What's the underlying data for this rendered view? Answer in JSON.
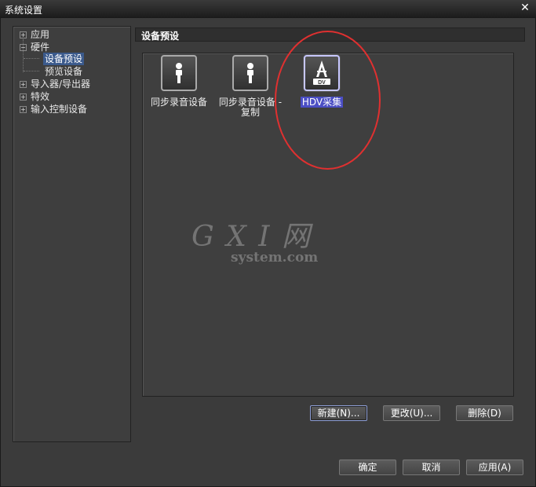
{
  "window": {
    "title": "系统设置"
  },
  "tree": {
    "items": [
      {
        "label": "应用",
        "expander": "+"
      },
      {
        "label": "硬件",
        "expander": "−"
      },
      {
        "label": "设备预设"
      },
      {
        "label": "预览设备"
      },
      {
        "label": "导入器/导出器",
        "expander": "+"
      },
      {
        "label": "特效",
        "expander": "+"
      },
      {
        "label": "输入控制设备",
        "expander": "+"
      }
    ]
  },
  "section": {
    "title": "设备预设"
  },
  "presets": [
    {
      "label": "同步录音设备",
      "icon": "microphone-icon"
    },
    {
      "label_line1": "同步录音设备 -",
      "label_line2": "复制",
      "icon": "microphone-icon"
    },
    {
      "label": "HDV采集",
      "icon": "hdv-dv-icon",
      "icon_text": "DV",
      "selected": true
    }
  ],
  "watermark": {
    "top": "G X I 网",
    "bottom": "system.com"
  },
  "buttons": {
    "new": "新建(N)...",
    "edit": "更改(U)...",
    "delete": "删除(D)",
    "ok": "确定",
    "cancel": "取消",
    "apply": "应用(A)"
  },
  "close": "✕",
  "colors": {
    "background": "#3a3a3a",
    "selection": "#4b4ec4",
    "annotation": "#e03030"
  }
}
